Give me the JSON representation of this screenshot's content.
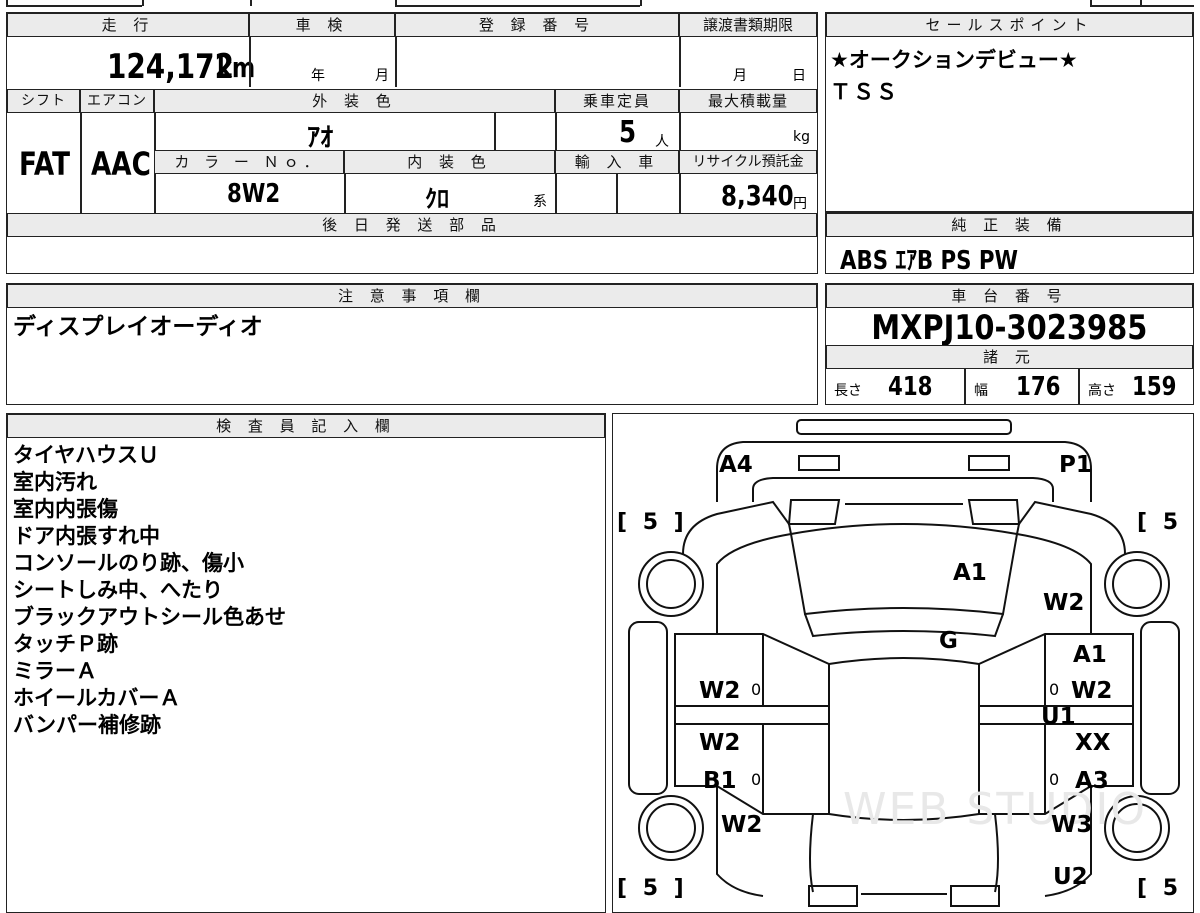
{
  "mileage": {
    "header": "走 行",
    "value": "124,172",
    "unit": "km"
  },
  "inspection": {
    "header": "車 検",
    "year_label": "年",
    "month_label": "月"
  },
  "registration": {
    "header": "登 録 番 号"
  },
  "transfer_deadline": {
    "header": "譲渡書類期限",
    "month_label": "月",
    "day_label": "日"
  },
  "sales_point": {
    "header": "セールスポイント",
    "lines": [
      "★オークションデビュー★",
      "ＴＳＳ"
    ]
  },
  "shift": {
    "header": "シフト",
    "value": "FAT"
  },
  "aircon": {
    "header": "エアコン",
    "value": "AAC"
  },
  "exterior_color": {
    "header": "外 装 色",
    "value": "ｱｵ"
  },
  "capacity": {
    "header": "乗車定員",
    "value": "5",
    "unit": "人"
  },
  "max_load": {
    "header": "最大積載量",
    "unit": "kg"
  },
  "color_no": {
    "header": "カ ラ ー Ｎｏ．",
    "value": "8W2"
  },
  "interior_color": {
    "header": "内 装 色",
    "value": "ｸﾛ",
    "suffix": "系"
  },
  "import": {
    "header": "輸 入 車"
  },
  "recycle": {
    "header": "リサイクル預託金",
    "value": "8,340",
    "unit": "円"
  },
  "later_parts": {
    "header": "後 日 発 送 部 品"
  },
  "genuine_equipment": {
    "header": "純 正 装 備",
    "value": "ABS ｴｱB PS PW"
  },
  "notes": {
    "header": "注 意 事 項 欄",
    "text": "ディスプレイオーディオ"
  },
  "chassis": {
    "header": "車 台 番 号",
    "value": "MXPJ10-3023985"
  },
  "specs": {
    "header": "諸 元",
    "length_label": "長さ",
    "length": "418",
    "width_label": "幅",
    "width": "176",
    "height_label": "高さ",
    "height": "159"
  },
  "inspector": {
    "header": "検 査 員 記 入 欄",
    "lines": [
      "タイヤハウスＵ",
      "室内汚れ",
      "室内内張傷",
      "ドア内張すれ中",
      "コンソールのり跡、傷小",
      "シートしみ中、へたり",
      "ブラックアウトシール色あせ",
      "タッチＰ跡",
      "ミラーＡ",
      "ホイールカバーＡ",
      "バンパー補修跡"
    ]
  },
  "diagram": {
    "brackets": {
      "fl": "[ 5 ]",
      "fr": "[ 5 ]",
      "rl": "[ 5 ]",
      "rr": "[ 5 ]"
    },
    "marks": {
      "front_left": "A4",
      "front_right": "P1",
      "hood": "A1",
      "fender_right": "W2",
      "windshield": "G",
      "front_door_right_1": "A1",
      "front_door_right_2": "W2",
      "front_door_right_3": "U1",
      "front_door_left": "W2",
      "rear_door_left_1": "W2",
      "rear_door_left_2": "B1",
      "rear_door_right_1": "XX",
      "rear_door_right_2": "A3",
      "rear_fender_left": "W2",
      "rear_fender_right": "W3",
      "rear_right": "U2",
      "zero_1": "0",
      "zero_2": "0",
      "zero_3": "0",
      "zero_4": "0"
    },
    "watermark": "WEB STUDIO"
  }
}
